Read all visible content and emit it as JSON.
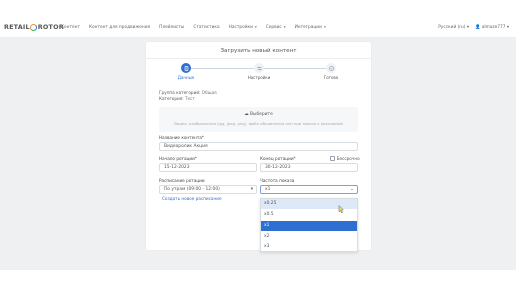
{
  "app": {
    "logo_left": "RETAIL",
    "logo_right": "ROTOR"
  },
  "nav": {
    "items": [
      {
        "label": "Контент",
        "has_caret": false
      },
      {
        "label": "Контент для продвижения",
        "has_caret": false
      },
      {
        "label": "Плейлисты",
        "has_caret": false
      },
      {
        "label": "Статистика",
        "has_caret": false
      },
      {
        "label": "Настройки",
        "has_caret": true
      },
      {
        "label": "Сервис",
        "has_caret": true
      },
      {
        "label": "Интеграции",
        "has_caret": true
      }
    ],
    "language": "Русский (ru)",
    "user": "almaze777"
  },
  "page": {
    "title": "Загрузить новый контент"
  },
  "stepper": {
    "steps": [
      {
        "label": "Данные",
        "icon": "document-icon",
        "active": true
      },
      {
        "label": "Настройки",
        "icon": "settings-icon",
        "active": false
      },
      {
        "label": "Готово",
        "icon": "check-icon",
        "active": false
      }
    ]
  },
  "meta": {
    "category_group_label": "Группа категорий:",
    "category_group_value": "Общая",
    "category_label": "Категория:",
    "category_value": "Тест"
  },
  "upload": {
    "title": "Выберите",
    "hint": "Видео, изображения (jpg, jpeg, png), файл объявления или при звонке к рекламной"
  },
  "form": {
    "content_name_label": "Название контента*",
    "content_name_value": "Видеоролик Акция",
    "start_label": "Начало ротации*",
    "start_value": "15-12-2023",
    "end_label": "Конец ротации*",
    "end_value": "30-12-2023",
    "unlimited_label": "Бессрочно",
    "schedule_label": "Расписание ротации",
    "schedule_value": "По утрам (09:00 - 12:00)",
    "create_schedule_link": "Создать новое расписание",
    "frequency_label": "Частота показа",
    "frequency_value": "x1"
  },
  "frequency_dropdown": {
    "options": [
      "x0.25",
      "x0.5",
      "x1",
      "x2",
      "x3"
    ],
    "hovered": "x0.25",
    "selected": "x1"
  },
  "colors": {
    "accent": "#2f6fd0",
    "page_bg": "#eef0f2",
    "hover": "#dde8f8"
  }
}
